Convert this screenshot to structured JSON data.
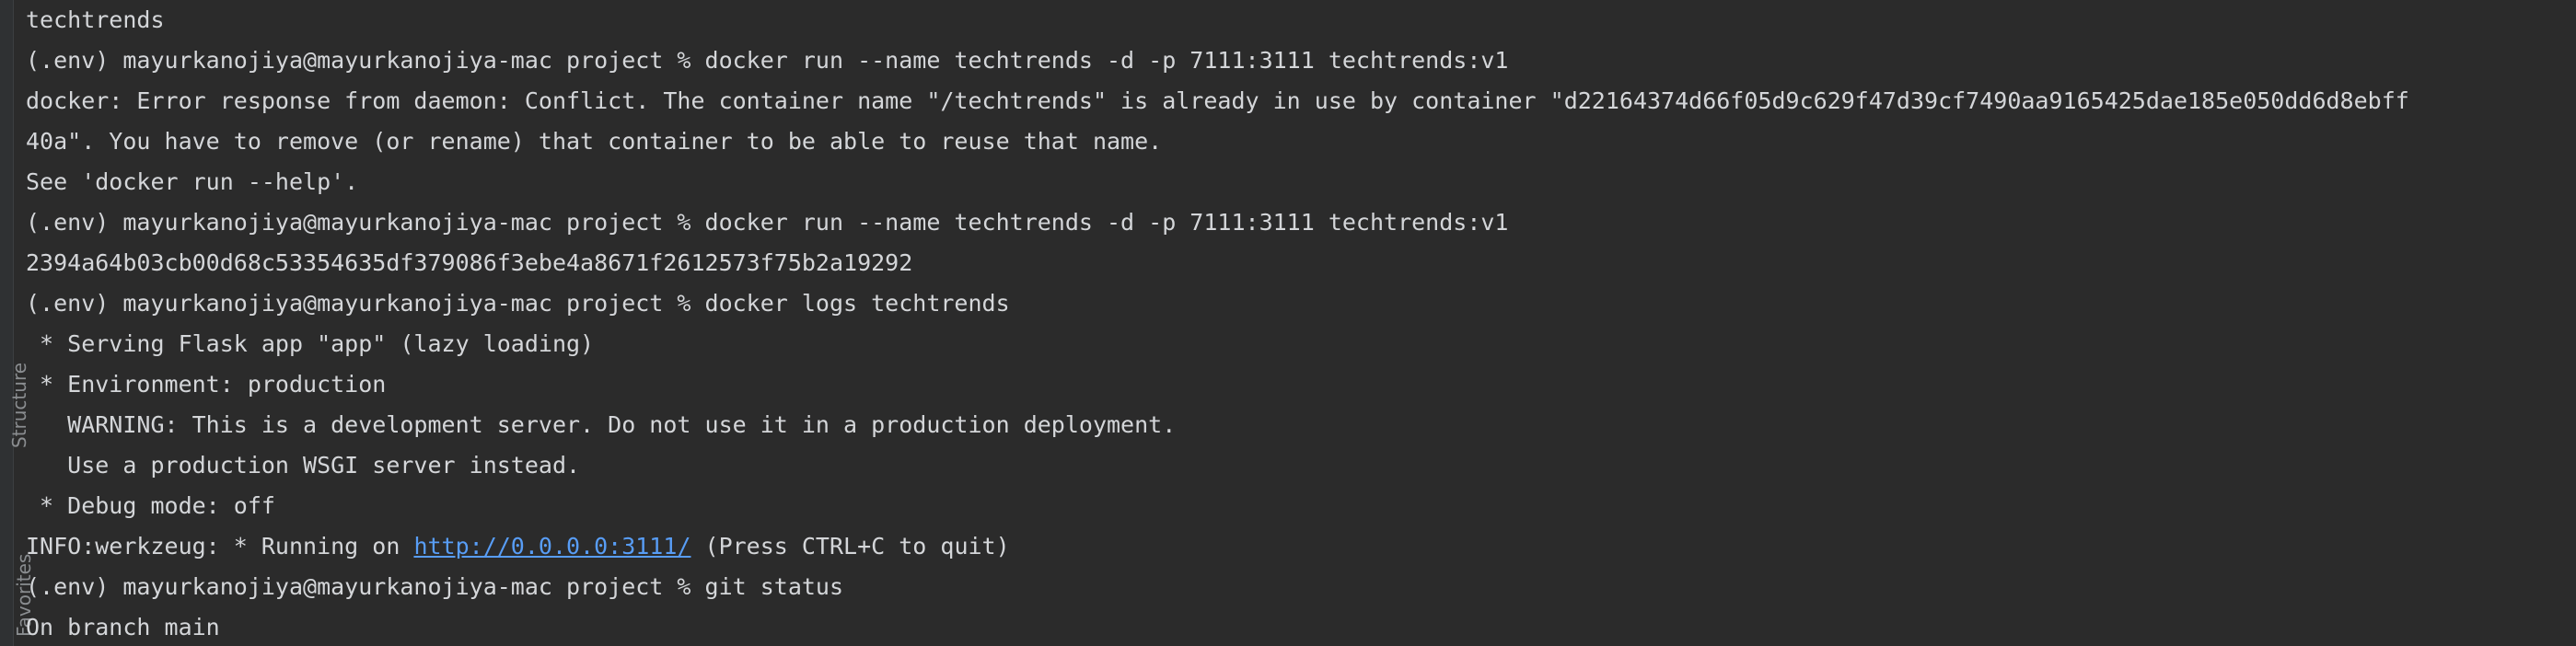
{
  "sidebar": {
    "structure_label": "Structure",
    "favorites_label": "Favorites"
  },
  "terminal": {
    "lines": [
      "techtrends",
      "(.env) mayurkanojiya@mayurkanojiya-mac project % docker run --name techtrends -d -p 7111:3111 techtrends:v1",
      "docker: Error response from daemon: Conflict. The container name \"/techtrends\" is already in use by container \"d22164374d66f05d9c629f47d39cf7490aa9165425dae185e050dd6d8ebff",
      "40a\". You have to remove (or rename) that container to be able to reuse that name.",
      "See 'docker run --help'.",
      "(.env) mayurkanojiya@mayurkanojiya-mac project % docker run --name techtrends -d -p 7111:3111 techtrends:v1",
      "2394a64b03cb00d68c53354635df379086f3ebe4a8671f2612573f75b2a19292",
      "(.env) mayurkanojiya@mayurkanojiya-mac project % docker logs techtrends",
      " * Serving Flask app \"app\" (lazy loading)",
      " * Environment: production",
      "   WARNING: This is a development server. Do not use it in a production deployment.",
      "   Use a production WSGI server instead.",
      " * Debug mode: off"
    ],
    "info_prefix": "INFO:werkzeug: * Running on ",
    "info_link": "http://0.0.0.0:3111/",
    "info_suffix": " (Press CTRL+C to quit)",
    "lines_after": [
      "(.env) mayurkanojiya@mayurkanojiya-mac project % git status",
      "On branch main"
    ]
  },
  "colors": {
    "background": "#2b2b2b",
    "text": "#d4d6d9",
    "link": "#589df6"
  }
}
